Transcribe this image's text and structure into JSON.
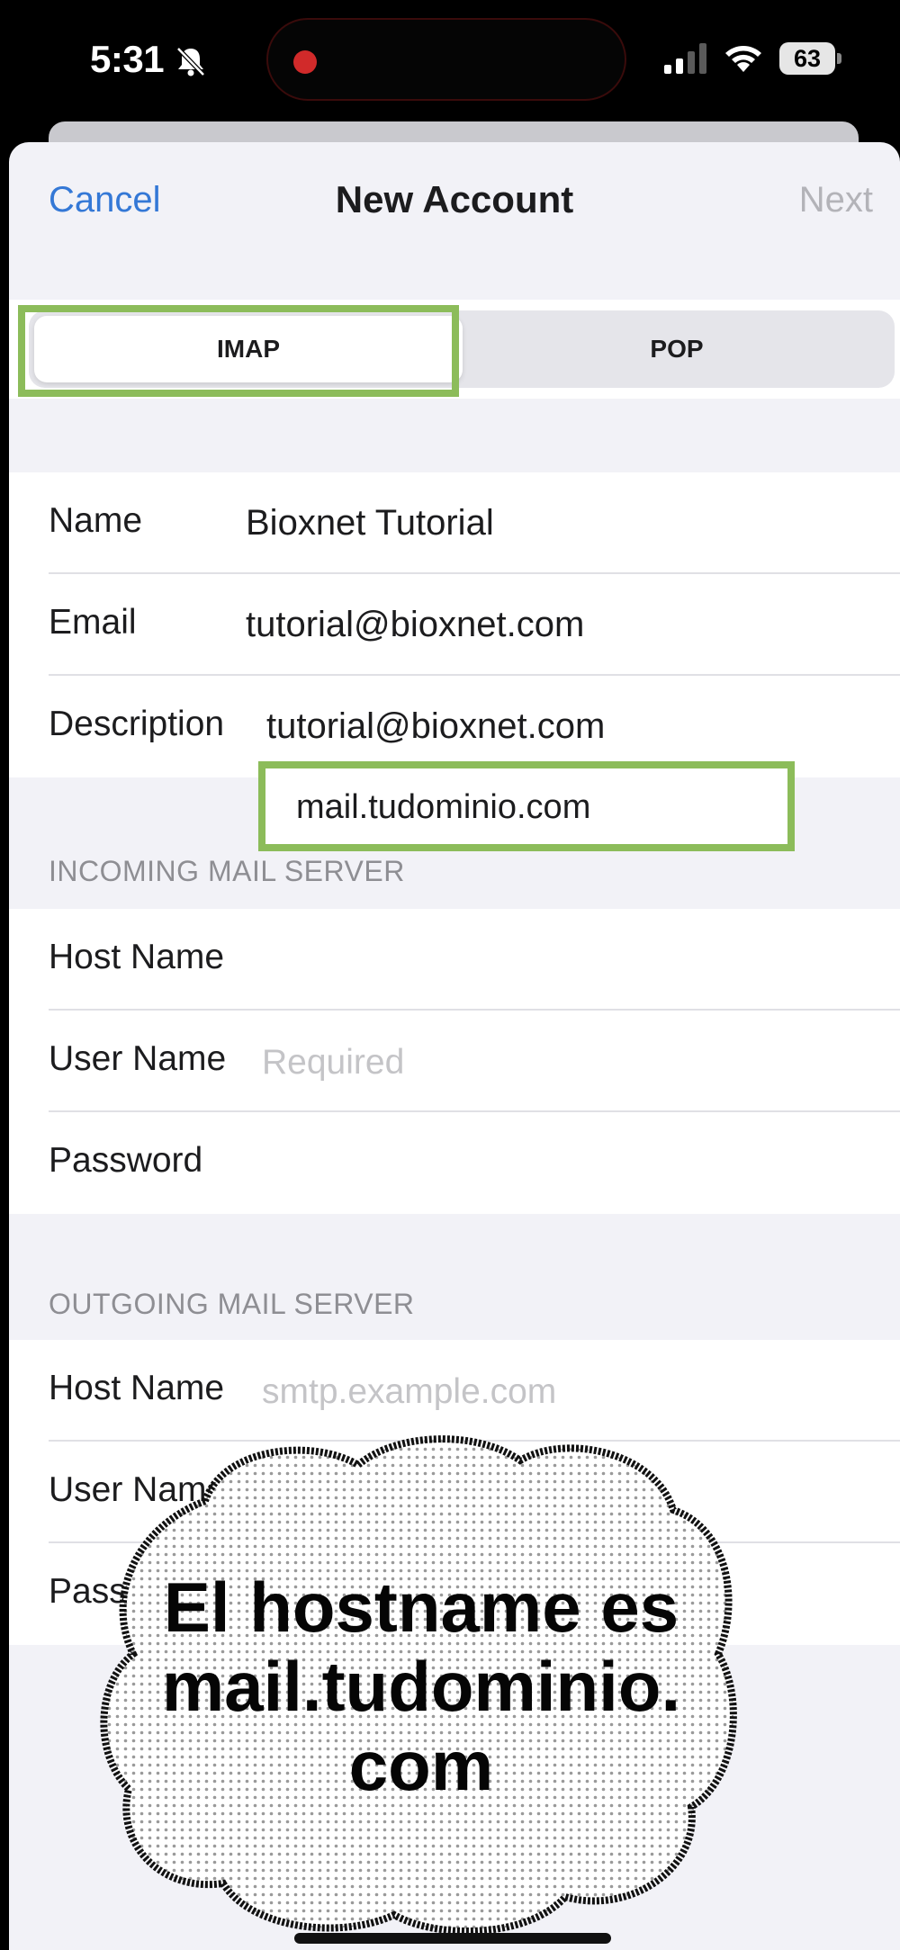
{
  "status_bar": {
    "time": "5:31",
    "battery": "63",
    "icons": [
      "bell-slash-icon",
      "signal-icon",
      "wifi-icon",
      "battery-icon"
    ]
  },
  "nav": {
    "cancel_label": "Cancel",
    "title": "New Account",
    "next_label": "Next"
  },
  "segment": {
    "options": [
      "IMAP",
      "POP"
    ],
    "selected": "IMAP"
  },
  "account": {
    "name_label": "Name",
    "name_value": "Bioxnet Tutorial",
    "email_label": "Email",
    "email_value": "tutorial@bioxnet.com",
    "description_label": "Description",
    "description_value": "tutorial@bioxnet.com"
  },
  "incoming": {
    "header": "INCOMING MAIL SERVER",
    "host_label": "Host Name",
    "host_value": "mail.tudominio.com",
    "user_label": "User Name",
    "user_placeholder": "Required",
    "password_label": "Password"
  },
  "outgoing": {
    "header": "OUTGOING MAIL SERVER",
    "host_label": "Host Name",
    "host_placeholder": "smtp.example.com",
    "user_label": "User Name",
    "password_label": "Password"
  },
  "caption": {
    "line1": "El hostname es",
    "line2": "mail.tudominio.",
    "line3": "com"
  },
  "colors": {
    "accent": "#3478d6",
    "highlight": "#8cbc5a"
  }
}
